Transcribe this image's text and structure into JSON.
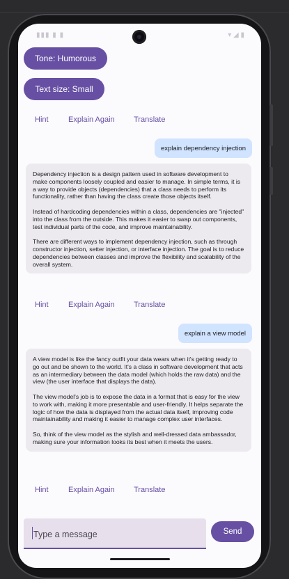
{
  "chips": {
    "tone_label": "Tone: Humorous",
    "text_size_label": "Text size: Small"
  },
  "actions": {
    "hint": "Hint",
    "explain_again": "Explain Again",
    "translate": "Translate"
  },
  "messages": [
    {
      "role": "user",
      "text": "explain dependency injection"
    },
    {
      "role": "assistant",
      "paragraphs": [
        "Dependency injection is a design pattern used in software development to make components loosely coupled and easier to manage. In simple terms, it is a way to provide objects (dependencies) that a class needs to perform its functionality, rather than having the class create those objects itself.",
        "Instead of hardcoding dependencies within a class, dependencies are \"injected\" into the class from the outside. This makes it easier to swap out components, test individual parts of the code, and improve maintainability.",
        "There are different ways to implement dependency injection, such as through constructor injection, setter injection, or interface injection. The goal is to reduce dependencies between classes and improve the flexibility and scalability of the overall system."
      ]
    },
    {
      "role": "user",
      "text": "explain a view model"
    },
    {
      "role": "assistant",
      "paragraphs": [
        "A view model is like the fancy outfit your data wears when it's getting ready to go out and be shown to the world. It's a class in software development that acts as an intermediary between the data model (which holds the raw data) and the view (the user interface that displays the data).",
        "The view model's job is to expose the data in a format that is easy for the view to work with, making it more presentable and user-friendly. It helps separate the logic of how the data is displayed from the actual data itself, improving code maintainability and making it easier to manage complex user interfaces.",
        "So, think of the view model as the stylish and well-dressed data ambassador, making sure your information looks its best when it meets the users."
      ]
    }
  ],
  "composer": {
    "placeholder": "Type a message",
    "send_label": "Send"
  },
  "colors": {
    "primary": "#6750a4",
    "user_bubble": "#d0e4ff",
    "bot_bubble": "#eceaee"
  }
}
